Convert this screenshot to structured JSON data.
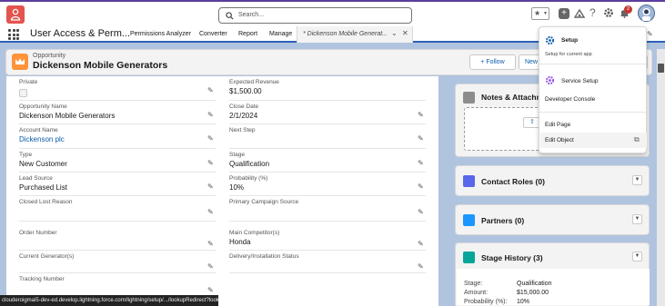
{
  "global": {
    "search_placeholder": "Search...",
    "notification_count": "2"
  },
  "nav": {
    "app_name": "User Access & Perm...",
    "items": [
      {
        "label": "Permissions Analyzer"
      },
      {
        "label": "Converter"
      },
      {
        "label": "Report"
      },
      {
        "label": "Manage"
      }
    ],
    "active_tab": "* Dickenson Mobile Generat..."
  },
  "record": {
    "object_label": "Opportunity",
    "name": "Dickenson Mobile Generators",
    "follow_label": "+ Follow",
    "new_label": "New",
    "partial_button_label": "te"
  },
  "fields": {
    "private": {
      "label": "Private"
    },
    "expected_revenue": {
      "label": "Expected Revenue",
      "value": "$1,500.00"
    },
    "opportunity_name": {
      "label": "Opportunity Name",
      "value": "Dickenson Mobile Generators"
    },
    "close_date": {
      "label": "Close Date",
      "value": "2/1/2024"
    },
    "account_name": {
      "label": "Account Name",
      "value": "Dickenson plc"
    },
    "next_step": {
      "label": "Next Step",
      "value": ""
    },
    "type": {
      "label": "Type",
      "value": "New Customer"
    },
    "stage": {
      "label": "Stage",
      "value": "Qualification"
    },
    "lead_source": {
      "label": "Lead Source",
      "value": "Purchased List"
    },
    "probability": {
      "label": "Probability (%)",
      "value": "10%"
    },
    "closed_lost_reason": {
      "label": "Closed Lost Reason",
      "value": ""
    },
    "primary_campaign": {
      "label": "Primary Campaign Source",
      "value": ""
    },
    "order_number": {
      "label": "Order Number",
      "value": ""
    },
    "main_competitor": {
      "label": "Main Competitor(s)",
      "value": "Honda"
    },
    "current_generator": {
      "label": "Current Generator(s)",
      "value": ""
    },
    "delivery_status": {
      "label": "Delivery/Installation Status",
      "value": ""
    },
    "tracking_number": {
      "label": "Tracking Number",
      "value": ""
    }
  },
  "related": {
    "notes_title": "Notes & Attachm",
    "contact_roles_title": "Contact Roles (0)",
    "partners_title": "Partners (0)",
    "stage_history_title": "Stage History (3)",
    "stage_history_rows": [
      {
        "key": "Stage:",
        "value": "Qualification"
      },
      {
        "key": "Amount:",
        "value": "$15,000.00"
      },
      {
        "key": "Probability (%):",
        "value": "10%"
      }
    ]
  },
  "setup_menu": {
    "setup_label": "Setup",
    "setup_sub": "Setup for current app",
    "service_setup_label": "Service Setup",
    "developer_console_label": "Developer Console",
    "edit_page_label": "Edit Page",
    "edit_object_label": "Edit Object"
  },
  "status_url": "clouderoigmai5-dev-ed.develop.lightning.force.com/lightning/setup/.../lookupRedirect?looku..."
}
